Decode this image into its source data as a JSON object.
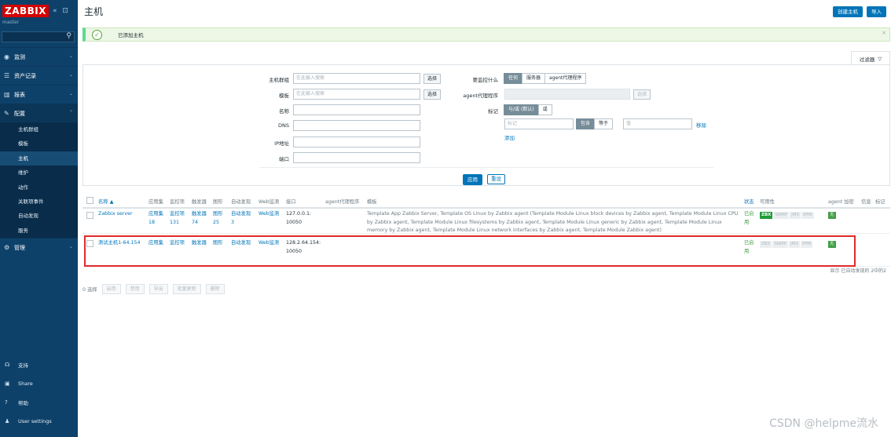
{
  "sidebar": {
    "logo": "ZABBIX",
    "collapse_icons": "« ⊡",
    "server_name": "master",
    "search_icon": "⚲",
    "menu": [
      {
        "label": "监测",
        "icon": "eye-icon"
      },
      {
        "label": "资产记录",
        "icon": "list-icon"
      },
      {
        "label": "报表",
        "icon": "chart-icon"
      },
      {
        "label": "配置",
        "icon": "wrench-icon"
      },
      {
        "label": "管理",
        "icon": "gear-icon"
      }
    ],
    "config_submenu": [
      "主机群组",
      "模板",
      "主机",
      "维护",
      "动作",
      "关联项事件",
      "自动发现",
      "服务"
    ],
    "bottom": [
      {
        "label": "支持",
        "icon": "support-icon"
      },
      {
        "label": "Share",
        "icon": "share-icon"
      },
      {
        "label": "帮助",
        "icon": "help-icon"
      },
      {
        "label": "User settings",
        "icon": "user-icon"
      }
    ]
  },
  "header": {
    "title": "主机",
    "create_button": "创建主机",
    "import_button": "导入"
  },
  "message": {
    "text": "已添加主机",
    "close": "×"
  },
  "filter": {
    "tab_label": "过滤器",
    "host_groups_label": "主机群组",
    "host_groups_placeholder": "在此输入搜索",
    "select": "选择",
    "templates_label": "模板",
    "templates_placeholder": "在此输入搜索",
    "name_label": "名称",
    "dns_label": "DNS",
    "ip_label": "IP地址",
    "port_label": "端口",
    "monitored_by_label": "要监控什么",
    "monitored_by_options": [
      "任何",
      "服务器",
      "agent代理程序"
    ],
    "proxy_label": "agent代理程序",
    "proxy_select": "选择",
    "tags_label": "标记",
    "tags_mode": [
      "与/或 (默认)",
      "或"
    ],
    "tag_placeholder": "标记",
    "tag_op": [
      "包含",
      "等于"
    ],
    "value_placeholder": "值",
    "remove": "移除",
    "add": "添加",
    "apply": "应用",
    "reset": "重设"
  },
  "table": {
    "headers": {
      "name": "名称 ▲",
      "apps": "应用集",
      "items": "监控项",
      "triggers": "触发器",
      "graphs": "图形",
      "discovery": "自动发现",
      "web": "Web监测",
      "interface": "接口",
      "proxy": "agent代理程序",
      "templates": "模板",
      "status": "状态",
      "availability": "可用性",
      "encryption": "agent 加密",
      "info": "信息",
      "tags": "标记"
    },
    "rows": [
      {
        "name": "Zabbix server",
        "apps": "应用集 18",
        "items": "监控项 131",
        "triggers": "触发器 74",
        "graphs": "图形 25",
        "discovery": "自动发现 3",
        "web": "Web监测",
        "interface": "127.0.0.1: 10050",
        "templates": "Template App Zabbix Server, Template OS Linux by Zabbix agent (Template Module Linux block devices by Zabbix agent, Template Module Linux CPU by Zabbix agent, Template Module Linux filesystems by Zabbix agent, Template Module Linux generic by Zabbix agent, Template Module Linux memory by Zabbix agent, Template Module Linux network interfaces by Zabbix agent, Template Module Zabbix agent)",
        "status": "已启用",
        "avail": [
          "ZBX",
          "SNMP",
          "JMX",
          "IPMI"
        ],
        "encryption": "无"
      },
      {
        "name": "测试主机1-64.154",
        "apps": "应用集",
        "items": "监控项",
        "triggers": "触发器",
        "graphs": "图形",
        "discovery": "自动发现",
        "web": "Web监测",
        "interface": "128.2.64.154: 10050",
        "templates": "",
        "status": "已启用",
        "avail": [
          "ZBX",
          "SNMP",
          "JMX",
          "IPMI"
        ],
        "encryption": "无"
      }
    ],
    "footer": "显示 已自动发现的 2中的2"
  },
  "actions": {
    "selected": "0 选择",
    "buttons": [
      "启用",
      "禁用",
      "导出",
      "批量更新",
      "删除"
    ]
  },
  "watermark": "CSDN @helpme流水",
  "colors": {
    "sidebar": "#0e4169",
    "primary": "#0275b8",
    "logo": "#d40000",
    "success": "#1f9c3a",
    "highlight": "#e02a2a"
  }
}
